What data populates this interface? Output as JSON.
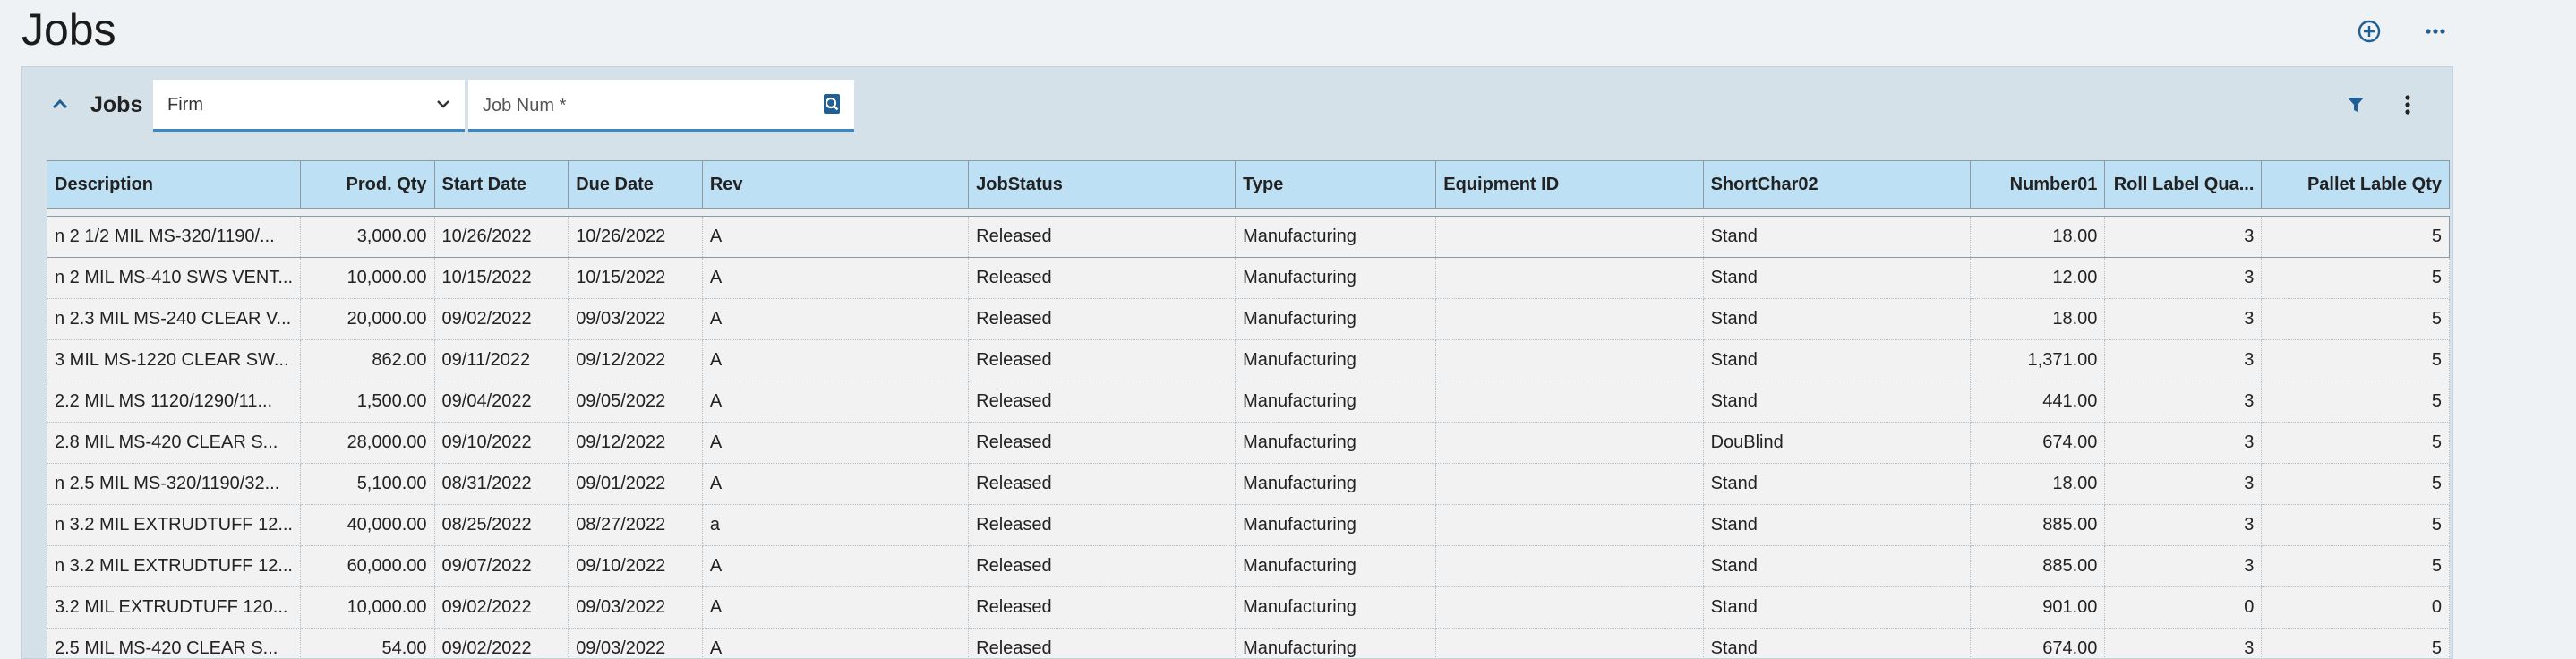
{
  "page": {
    "title": "Jobs"
  },
  "panel": {
    "title": "Jobs",
    "company_select": {
      "value": "Firm"
    },
    "job_search": {
      "placeholder": "Job Num *",
      "value": ""
    }
  },
  "colors": {
    "accent": "#3a87c3",
    "header_bg": "#bee0f4",
    "panel_bg": "#d5e1e8"
  },
  "icons": [
    "add-circle-icon",
    "more-horizontal-icon",
    "chevron-up-icon",
    "chevron-down-icon",
    "search-icon",
    "filter-icon",
    "more-vertical-icon"
  ],
  "grid": {
    "columns": [
      {
        "label": "Description",
        "align": "left"
      },
      {
        "label": "Prod. Qty",
        "align": "right"
      },
      {
        "label": "Start Date",
        "align": "left"
      },
      {
        "label": "Due Date",
        "align": "left"
      },
      {
        "label": "Rev",
        "align": "left"
      },
      {
        "label": "JobStatus",
        "align": "left"
      },
      {
        "label": "Type",
        "align": "left"
      },
      {
        "label": "Equipment ID",
        "align": "left"
      },
      {
        "label": "ShortChar02",
        "align": "left"
      },
      {
        "label": "Number01",
        "align": "right"
      },
      {
        "label": "Roll Label Qua...",
        "align": "right"
      },
      {
        "label": "Pallet Lable Qty",
        "align": "right"
      }
    ],
    "rows": [
      [
        "n 2 1/2 MIL MS-320/1190/...",
        "3,000.00",
        "10/26/2022",
        "10/26/2022",
        "A",
        "Released",
        "Manufacturing",
        "",
        "Stand",
        "18.00",
        "3",
        "5"
      ],
      [
        "n 2 MIL MS-410 SWS VENT...",
        "10,000.00",
        "10/15/2022",
        "10/15/2022",
        "A",
        "Released",
        "Manufacturing",
        "",
        "Stand",
        "12.00",
        "3",
        "5"
      ],
      [
        "n 2.3 MIL MS-240 CLEAR V...",
        "20,000.00",
        "09/02/2022",
        "09/03/2022",
        "A",
        "Released",
        "Manufacturing",
        "",
        "Stand",
        "18.00",
        "3",
        "5"
      ],
      [
        "3 MIL MS-1220 CLEAR SW...",
        "862.00",
        "09/11/2022",
        "09/12/2022",
        "A",
        "Released",
        "Manufacturing",
        "",
        "Stand",
        "1,371.00",
        "3",
        "5"
      ],
      [
        "2.2 MIL MS 1120/1290/11...",
        "1,500.00",
        "09/04/2022",
        "09/05/2022",
        "A",
        "Released",
        "Manufacturing",
        "",
        "Stand",
        "441.00",
        "3",
        "5"
      ],
      [
        "2.8 MIL MS-420 CLEAR S...",
        "28,000.00",
        "09/10/2022",
        "09/12/2022",
        "A",
        "Released",
        "Manufacturing",
        "",
        "DouBlind",
        "674.00",
        "3",
        "5"
      ],
      [
        "n 2.5 MIL MS-320/1190/32...",
        "5,100.00",
        "08/31/2022",
        "09/01/2022",
        "A",
        "Released",
        "Manufacturing",
        "",
        "Stand",
        "18.00",
        "3",
        "5"
      ],
      [
        "n 3.2 MIL EXTRUDTUFF 12...",
        "40,000.00",
        "08/25/2022",
        "08/27/2022",
        "a",
        "Released",
        "Manufacturing",
        "",
        "Stand",
        "885.00",
        "3",
        "5"
      ],
      [
        "n 3.2 MIL EXTRUDTUFF 12...",
        "60,000.00",
        "09/07/2022",
        "09/10/2022",
        "A",
        "Released",
        "Manufacturing",
        "",
        "Stand",
        "885.00",
        "3",
        "5"
      ],
      [
        "3.2 MIL EXTRUDTUFF 120...",
        "10,000.00",
        "09/02/2022",
        "09/03/2022",
        "A",
        "Released",
        "Manufacturing",
        "",
        "Stand",
        "901.00",
        "0",
        "0"
      ],
      [
        "2.5 MIL MS-420 CLEAR S...",
        "54.00",
        "09/02/2022",
        "09/03/2022",
        "A",
        "Released",
        "Manufacturing",
        "",
        "Stand",
        "674.00",
        "3",
        "5"
      ]
    ]
  }
}
